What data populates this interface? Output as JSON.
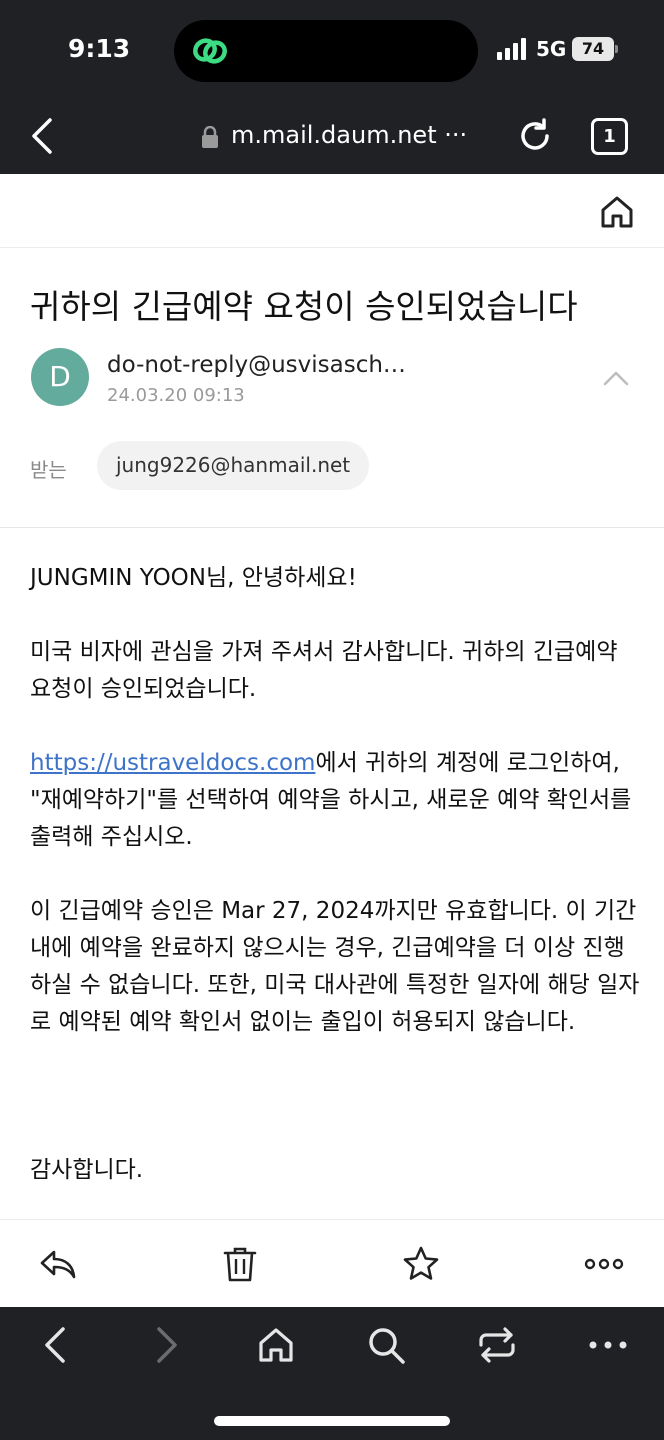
{
  "status_bar": {
    "time": "9:13",
    "network": "5G",
    "battery": "74",
    "island_icon": "link-icon",
    "island_icon_color": "#3ddc84"
  },
  "browser": {
    "url": "m.mail.daum.net ···",
    "tab_count": "1"
  },
  "email": {
    "subject": "귀하의 긴급예약 요청이 승인되었습니다",
    "sender_initial": "D",
    "sender": "do-not-reply@usvisaschedule.com",
    "date": "24.03.20 09:13",
    "to_label": "받는",
    "to": "jung9226@hanmail.net",
    "avatar_color": "#63ab9c",
    "link_color": "#3d73c9",
    "body": {
      "greeting": "JUNGMIN YOON님, 안녕하세요!",
      "p1": "미국 비자에 관심을 가져 주셔서 감사합니다. 귀하의 긴급예약 요청이 승인되었습니다.",
      "p2_link": "https://ustraveldocs.com",
      "p2_rest": "에서 귀하의 계정에 로그인하여, \"재예약하기\"를 선택하여 예약을 하시고, 새로운 예약 확인서를 출력해 주십시오.",
      "p3": "이 긴급예약 승인은 Mar 27, 2024까지만 유효합니다. 이 기간내에 예약을 완료하지 않으시는 경우, 긴급예약을 더 이상 진행하실 수 없습니다. 또한, 미국 대사관에 특정한 일자에 해당 일자로 예약된 예약 확인서 없이는 출입이 허용되지 않습니다.",
      "closing": "감사합니다."
    }
  },
  "mail_toolbar": [
    "reply-icon",
    "trash-icon",
    "star-icon",
    "more-dots-icon"
  ],
  "browser_toolbar": [
    "back-icon",
    "forward-icon",
    "home-icon",
    "search-icon",
    "tabs-switch-icon",
    "menu-dots-icon"
  ]
}
